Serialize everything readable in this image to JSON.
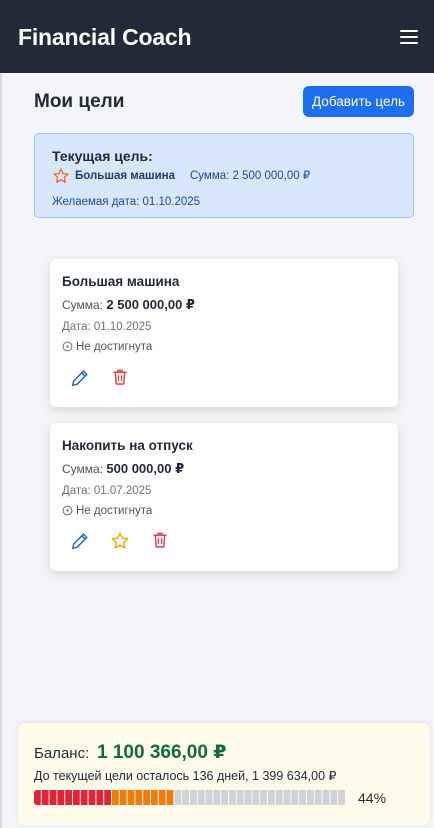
{
  "app": {
    "title": "Financial Coach"
  },
  "page": {
    "title": "Мои цели",
    "add_button": "Добавить цель"
  },
  "current_goal": {
    "heading": "Текущая цель:",
    "name": "Большая машина",
    "amount": "Сумма: 2 500 000,00 ₽",
    "desired_date": "Желаемая дата: 01.10.2025"
  },
  "goals": [
    {
      "title": "Большая машина",
      "amount_label": "Сумма:",
      "amount": "2 500 000,00 ₽",
      "date": "Дата: 01.10.2025",
      "status": "Не достигнута",
      "actions": [
        "edit-icon",
        "trash-icon"
      ]
    },
    {
      "title": "Накопить на отпуск",
      "amount_label": "Сумма:",
      "amount": "500 000,00 ₽",
      "date": "Дата: 01.07.2025",
      "status": "Не достигнута",
      "actions": [
        "edit-icon",
        "star-icon",
        "trash-icon"
      ]
    }
  ],
  "balance": {
    "label": "Баланс:",
    "value": "1 100 366,00 ₽",
    "remaining": "До текущей цели осталось 136 дней, 1 399 634,00 ₽",
    "progress_percent": 44,
    "progress_label": "44%"
  },
  "colors": {
    "navbar": "#222a38",
    "accent": "#1e6ff0",
    "balance": "#156a3c",
    "progress_red": "#e2233a",
    "progress_orange": "#f07c0c",
    "progress_empty": "#d0d3d8",
    "star_current": "#ef6c2c",
    "star_action": "#e8b10a",
    "trash": "#e2434b",
    "edit": "#2b63c4"
  }
}
